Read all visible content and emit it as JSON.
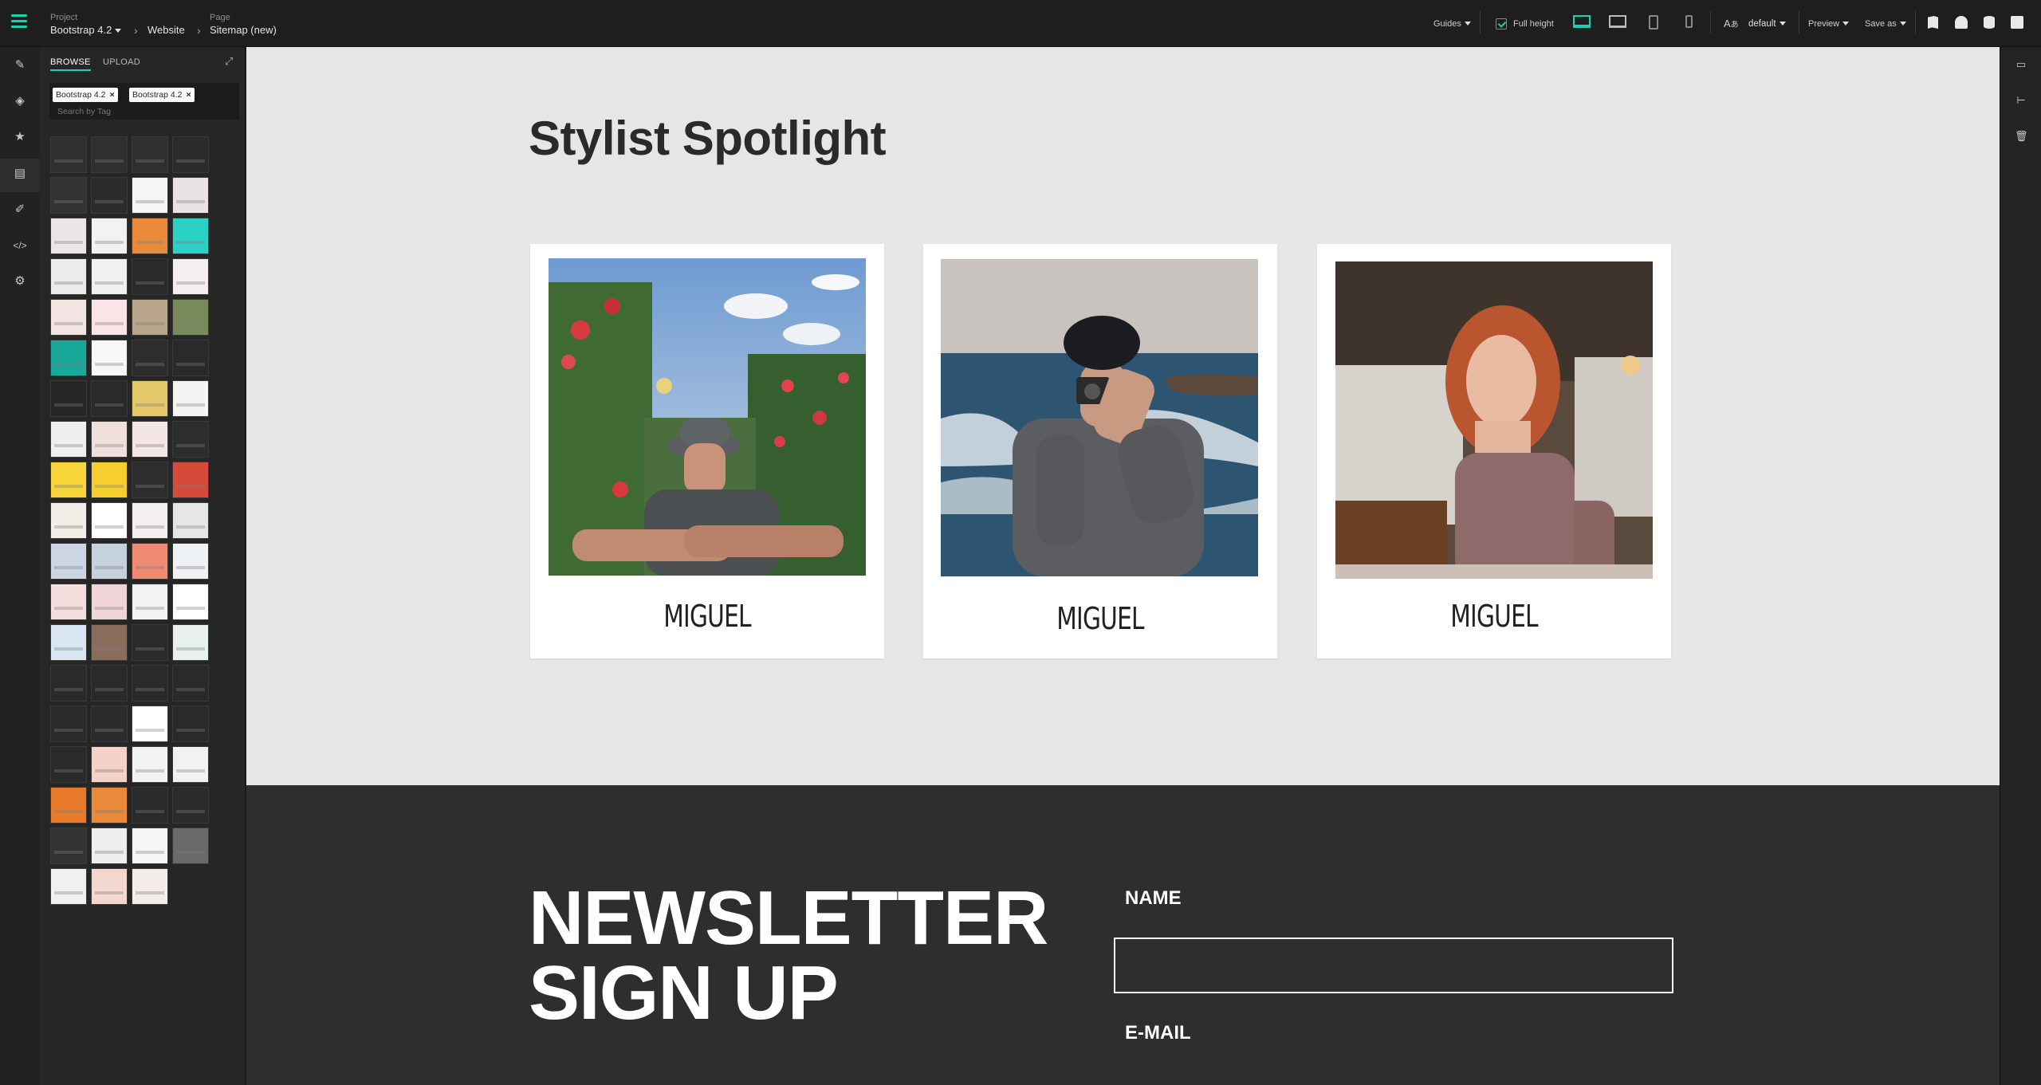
{
  "topbar": {
    "project_label": "Project",
    "project_value": "Bootstrap 4.2",
    "website_value": "Website",
    "page_label": "Page",
    "page_value": "Sitemap (new)",
    "guides": "Guides",
    "full_height": "Full height",
    "default": "default",
    "preview": "Preview",
    "save_as": "Save as"
  },
  "panel": {
    "tab_browse": "BROWSE",
    "tab_upload": "UPLOAD",
    "tags": [
      "Bootstrap 4.2",
      "Bootstrap 4.2"
    ],
    "tag_search_placeholder": "Search by Tag"
  },
  "canvas": {
    "spotlight_title": "Stylist Spotlight",
    "cards": [
      {
        "name": "MIGUEL"
      },
      {
        "name": "MIGUEL"
      },
      {
        "name": "MIGUEL"
      }
    ],
    "newsletter_title_line1": "NEWSLETTER",
    "newsletter_title_line2": "SIGN UP",
    "name_label": "NAME",
    "email_label": "E-MAIL"
  },
  "colors": {
    "accent": "#1ad1b2",
    "canvas_bg": "#e6e6e6",
    "newsletter_bg": "#2e2e2e"
  }
}
